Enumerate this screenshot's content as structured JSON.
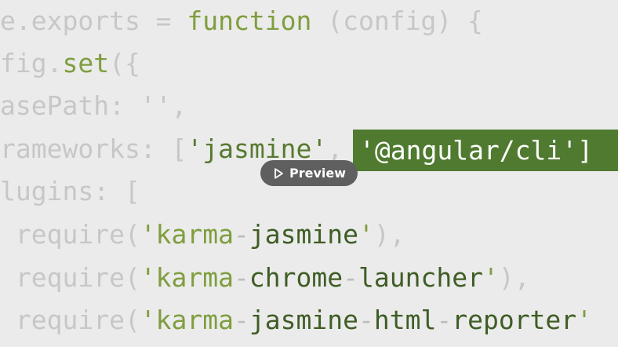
{
  "code": {
    "lines": [
      {
        "tokens": [
          {
            "text": "e.exports = ",
            "kind": "plain"
          },
          {
            "text": "function",
            "kind": "kw"
          },
          {
            "text": " (config) {",
            "kind": "plain"
          }
        ]
      },
      {
        "tokens": [
          {
            "text": "fig.",
            "kind": "plain"
          },
          {
            "text": "set",
            "kind": "fn"
          },
          {
            "text": "({",
            "kind": "plain"
          }
        ]
      },
      {
        "tokens": [
          {
            "text": "asePath: '',",
            "kind": "plain"
          }
        ]
      },
      {
        "tokens": [
          {
            "text": "rameworks: [",
            "kind": "plain"
          },
          {
            "text": "'jasmine'",
            "kind": "str-main"
          },
          {
            "text": ", ",
            "kind": "plain"
          }
        ]
      },
      {
        "tokens": [
          {
            "text": "lugins: [",
            "kind": "plain"
          }
        ]
      },
      {
        "tokens": [
          {
            "text": " require(",
            "kind": "plain"
          },
          {
            "text": "'karma",
            "kind": "str-q"
          },
          {
            "text": "-",
            "kind": "dash"
          },
          {
            "text": "jasmine",
            "kind": "str-dark"
          },
          {
            "text": "'",
            "kind": "str-q"
          },
          {
            "text": "),",
            "kind": "plain"
          }
        ]
      },
      {
        "tokens": [
          {
            "text": " require(",
            "kind": "plain"
          },
          {
            "text": "'karma",
            "kind": "str-q"
          },
          {
            "text": "-",
            "kind": "dash"
          },
          {
            "text": "chrome",
            "kind": "str-dark"
          },
          {
            "text": "-",
            "kind": "dash"
          },
          {
            "text": "launcher",
            "kind": "str-dark"
          },
          {
            "text": "'",
            "kind": "str-q"
          },
          {
            "text": "),",
            "kind": "plain"
          }
        ]
      },
      {
        "tokens": [
          {
            "text": " require(",
            "kind": "plain"
          },
          {
            "text": "'karma",
            "kind": "str-q"
          },
          {
            "text": "-",
            "kind": "dash"
          },
          {
            "text": "jasmine",
            "kind": "str-dark"
          },
          {
            "text": "-",
            "kind": "dash"
          },
          {
            "text": "html",
            "kind": "str-dark"
          },
          {
            "text": "-",
            "kind": "dash"
          },
          {
            "text": "reporter",
            "kind": "str-dark"
          },
          {
            "text": "'",
            "kind": "str-q"
          }
        ]
      }
    ],
    "selection_text": "'@angular/cli']"
  },
  "preview": {
    "label": "Preview",
    "icon": "play-icon"
  },
  "colors": {
    "background": "#ebebeb",
    "selection": "#4f7a2f",
    "string": "#587a2f",
    "keyword": "#7f9e3e",
    "muted_text": "#c7c7c7",
    "button_bg": "#5f5f5f"
  }
}
